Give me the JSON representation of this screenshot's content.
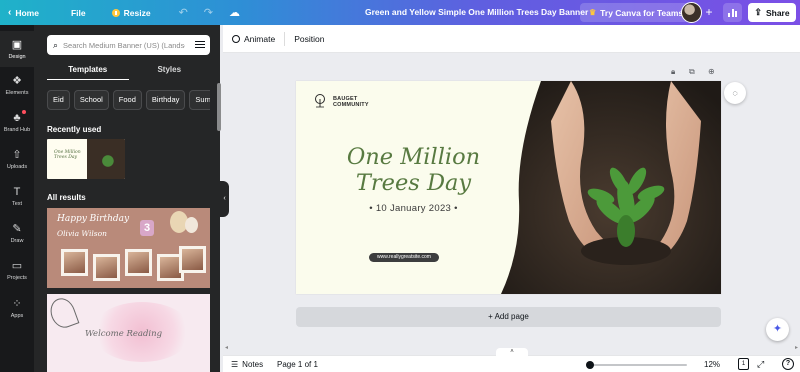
{
  "topbar": {
    "home_label": "Home",
    "file_label": "File",
    "resize_label": "Resize",
    "doc_title": "Green and Yellow Simple One Million Trees Day Banner",
    "try_teams_label": "Try Canva for Teams",
    "share_label": "Share",
    "icons": [
      "chevron-left-icon",
      "resize-icon",
      "undo-icon",
      "redo-icon",
      "cloud-icon",
      "crown-icon",
      "plus-icon",
      "stats-icon",
      "share-icon"
    ]
  },
  "rail": {
    "items": [
      {
        "label": "Design",
        "icon": "design-icon"
      },
      {
        "label": "Elements",
        "icon": "elements-icon"
      },
      {
        "label": "Brand Hub",
        "icon": "brand-icon"
      },
      {
        "label": "Uploads",
        "icon": "uploads-icon"
      },
      {
        "label": "Text",
        "icon": "text-icon"
      },
      {
        "label": "Draw",
        "icon": "draw-icon"
      },
      {
        "label": "Projects",
        "icon": "folder-icon"
      },
      {
        "label": "Apps",
        "icon": "apps-icon"
      }
    ]
  },
  "panel": {
    "search_placeholder": "Search Medium Banner (US) (Landscape) templates",
    "tabs": [
      "Templates",
      "Styles"
    ],
    "chips": [
      "Eid",
      "School",
      "Food",
      "Birthday",
      "Summer"
    ],
    "recently_used_title": "Recently used",
    "all_results_title": "All results",
    "recent_thumb_text": "One Million Trees Day",
    "birthday_line1": "Happy Birthday",
    "birthday_line2": "Olivia Wilson",
    "birthday_number": "3",
    "watercolor_text": "Welcome Reading"
  },
  "toolbar": {
    "animate_label": "Animate",
    "position_label": "Position"
  },
  "design": {
    "brand_line1": "BAUGET",
    "brand_line2": "COMMUNITY",
    "headline_line1": "One Million",
    "headline_line2": "Trees Day",
    "date": "• 10 January 2023 •",
    "url": "www.reallygreatsite.com",
    "colors": {
      "background": "#fbfced",
      "headline": "#587a41"
    }
  },
  "canvas": {
    "add_page_label": "+ Add page"
  },
  "bottombar": {
    "notes_label": "Notes",
    "page_info": "Page 1 of 1",
    "zoom": "12%",
    "pages_count": "1"
  }
}
